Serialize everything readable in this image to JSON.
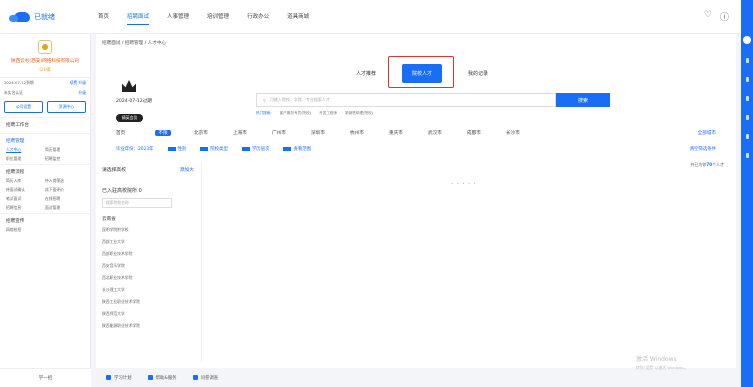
{
  "logo": {
    "text": "已就绪"
  },
  "nav": {
    "items": [
      "首页",
      "招聘面试",
      "人事管理",
      "培训管理",
      "行政办公",
      "道具商城"
    ],
    "active_index": 1
  },
  "top_icons": {
    "notify": "bell-icon",
    "help": "help-icon"
  },
  "company": {
    "name": "陕西云杉(西安)网络科技有限公司",
    "level": "Q1级",
    "date_row_left": "2024-07-12到期",
    "date_row_right": "续费 升级",
    "auth_row_left": "未实名认证",
    "auth_row_right": "升级",
    "btn_left": "公司设置",
    "btn_right": "资源中心"
  },
  "menu": {
    "workbench": "招聘工作台",
    "mgmt_title": "招聘管理",
    "mgmt_items": [
      "人才中心",
      "简历管理",
      "职位管理",
      "招聘监控"
    ],
    "process_title": "招聘流程",
    "process_items": [
      "简历入库",
      "待入岗筛选",
      "待面试确认",
      "成下面评价",
      "笔试面试",
      "在线招聘",
      "招聘信息",
      "面试管理"
    ],
    "campus_title": "招聘宣传",
    "campus_items": [
      "网络校招"
    ]
  },
  "sidebar_footer": {
    "label": "学一招"
  },
  "breadcrumb": "招聘面试 / 招聘管理 / 人才中心",
  "tabs": [
    {
      "label": "人才推荐",
      "active": false
    },
    {
      "label": "院校人才",
      "active": true
    },
    {
      "label": "我的记录",
      "active": false
    }
  ],
  "profile": {
    "date": "2024-07-12过期",
    "badge": "精英会员"
  },
  "search": {
    "placeholder": "可输入院校、学院、专业搜索人才",
    "button": "搜索"
  },
  "hot": {
    "prefix": "热门搜索:",
    "items": [
      "客户服务专员(院校)",
      "开发工程师",
      "新销售助理(院校)"
    ]
  },
  "cities": [
    "首页",
    "不限",
    "北京市",
    "上海市",
    "广州市",
    "深圳市",
    "杭州市",
    "重庆市",
    "武汉市",
    "成都市",
    "长沙市"
  ],
  "cities_all": "全部城市",
  "filters": {
    "items": [
      "毕业年份：2023年",
      "性别",
      "院校类型",
      "学历层次",
      "查看范围"
    ],
    "clear": "清空筛选条件"
  },
  "left_panel": {
    "head": "请选择高校",
    "head_link": "添加大",
    "sub": "已入驻高校院所 0",
    "search_placeholder": "搜索院校名称",
    "province": "云南省",
    "schools": [
      "昆明学院附学校",
      "西部工业大学",
      "西部职业技术学院",
      "西安音乐学院",
      "西北职业技术学院",
      "长沙理工大学",
      "陕西工业职业技术学院",
      "陕西师范大学",
      "陕西能源职业技术学院"
    ]
  },
  "result": {
    "prefix": "共已为你",
    "count": "70",
    "suffix": "个人才"
  },
  "loading_text": "• • • • •",
  "watermark": {
    "line1": "激活 Windows",
    "line2": "转到\"设置\"以激活 Windows。"
  },
  "bottom": {
    "items": [
      "学习计划",
      "帮助&服务",
      "问卷调查"
    ]
  }
}
